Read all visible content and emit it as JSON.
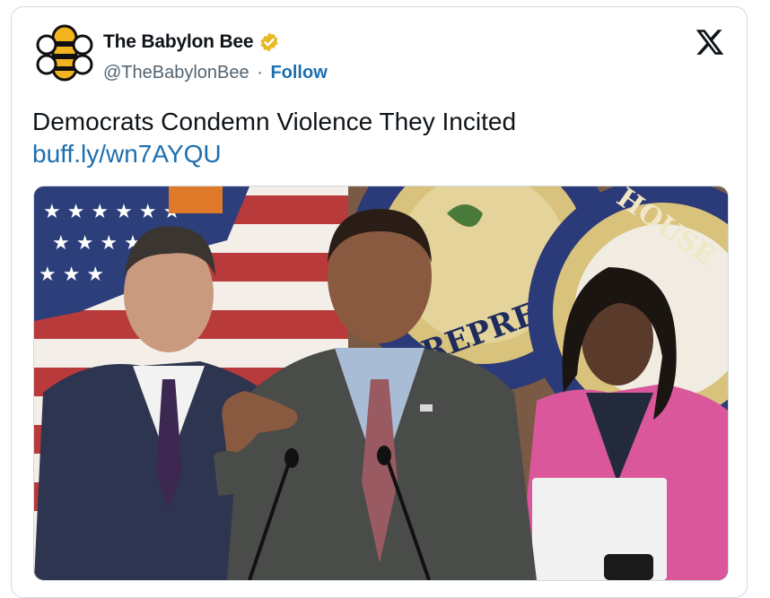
{
  "account": {
    "display_name": "The Babylon Bee",
    "handle": "@TheBabylonBee",
    "separator": "·",
    "follow_label": "Follow",
    "verified": true,
    "verified_color": "#e8b829"
  },
  "tweet": {
    "text": "Democrats Condemn Violence They Incited",
    "link": "buff.ly/wn7AYQU"
  },
  "media": {
    "type": "photo",
    "description_icon": "press-conference-photo",
    "seal_text": "REPRESE",
    "seal_text_right": "HOUSE"
  },
  "icons": {
    "logo": "x-logo-icon",
    "avatar": "babylon-bee-logo-icon",
    "badge": "verified-badge-icon"
  },
  "colors": {
    "link": "#1d6fb0",
    "border": "#cfd9de",
    "muted_text": "#536471",
    "avatar_yellow": "#f2b51f"
  }
}
